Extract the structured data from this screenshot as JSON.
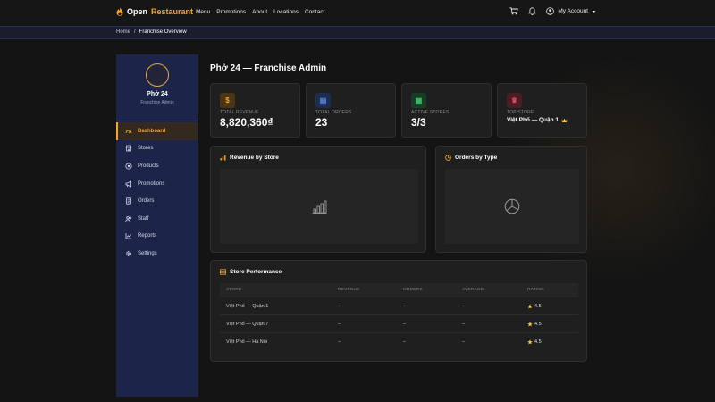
{
  "nav": {
    "brand_first": "Open",
    "brand_second": "Restaurant",
    "links": [
      "Menu",
      "Promotions",
      "About",
      "Locations",
      "Contact"
    ],
    "account_label": "My Account"
  },
  "breadcrumb": {
    "home": "Home",
    "separator": "/",
    "current": "Franchise Overview"
  },
  "profile": {
    "name": "Phở 24",
    "role": "Franchise Admin"
  },
  "sidebar": {
    "items": [
      {
        "label": "Dashboard",
        "icon": "dashboard-icon",
        "active": true
      },
      {
        "label": "Stores",
        "icon": "store-icon"
      },
      {
        "label": "Products",
        "icon": "product-icon"
      },
      {
        "label": "Promotions",
        "icon": "megaphone-icon"
      },
      {
        "label": "Orders",
        "icon": "orders-icon"
      },
      {
        "label": "Staff",
        "icon": "staff-icon"
      },
      {
        "label": "Reports",
        "icon": "chart-line-icon"
      },
      {
        "label": "Settings",
        "icon": "gear-icon"
      }
    ]
  },
  "page": {
    "title": "Phở 24 — Franchise Admin"
  },
  "stats": [
    {
      "label": "TOTAL REVENUE",
      "value": "8,820,360₫",
      "icon_glyph": "$",
      "icon": "dollar-icon",
      "color": "#f5a623",
      "bg": "#4a3616"
    },
    {
      "label": "TOTAL ORDERS",
      "value": "23",
      "icon_glyph": "▤",
      "icon": "receipt-icon",
      "color": "#5b8def",
      "bg": "#1e2c52"
    },
    {
      "label": "ACTIVE STORES",
      "value": "3/3",
      "icon_glyph": "▦",
      "icon": "building-icon",
      "color": "#3fbf6a",
      "bg": "#173d26"
    },
    {
      "label": "TOP STORE",
      "value": "Việt Phố — Quận 1",
      "icon_glyph": "♛",
      "icon": "trophy-icon",
      "color": "#e0485a",
      "bg": "#4a1c24"
    }
  ],
  "panels": {
    "revenue_title": "Revenue by Store",
    "orders_title": "Orders by Type"
  },
  "table": {
    "title": "Store Performance",
    "columns": [
      "STORE",
      "REVENUE",
      "ORDERS",
      "AVERAGE",
      "RATING"
    ],
    "rows": [
      {
        "store": "Việt Phố — Quận 1",
        "revenue": "–",
        "orders": "–",
        "average": "–",
        "rating": "4.5"
      },
      {
        "store": "Việt Phố — Quận 7",
        "revenue": "–",
        "orders": "–",
        "average": "–",
        "rating": "4.5"
      },
      {
        "store": "Việt Phố — Hà Nội",
        "revenue": "–",
        "orders": "–",
        "average": "–",
        "rating": "4.5"
      }
    ]
  },
  "colors": {
    "accent": "#f5a623",
    "sidebar": "#1c2549",
    "background": "#141414",
    "card": "#1f1f1f"
  }
}
